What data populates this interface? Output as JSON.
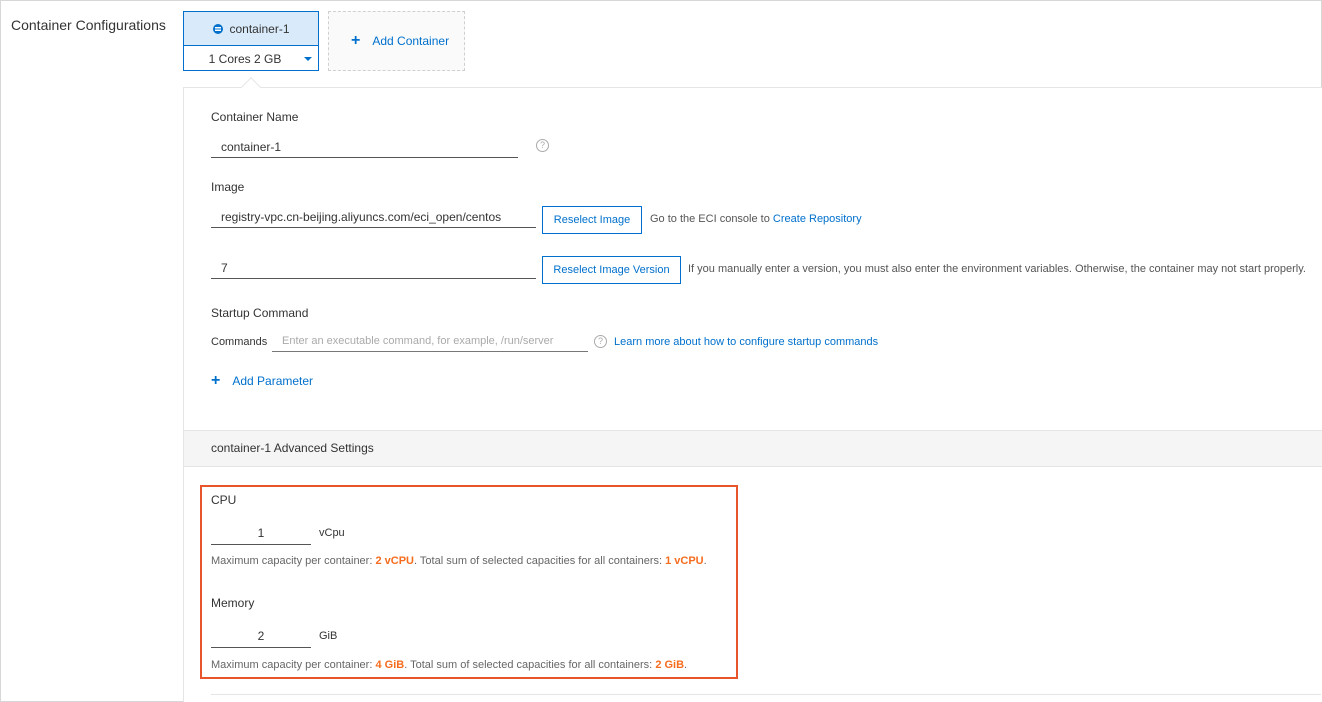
{
  "section": {
    "label": "Container Configurations"
  },
  "container_tab": {
    "name": "container-1",
    "spec": "1 Cores 2 GB"
  },
  "add_container": {
    "label": "Add Container"
  },
  "form": {
    "container_name": {
      "label": "Container Name",
      "value": "container-1"
    },
    "image": {
      "label": "Image",
      "value": "registry-vpc.cn-beijing.aliyuncs.com/eci_open/centos",
      "reselect_label": "Reselect Image",
      "hint_prefix": "Go to the ECI console to",
      "hint_link": "Create Repository"
    },
    "image_version": {
      "value": "7",
      "reselect_label": "Reselect Image Version",
      "hint": "If you manually enter a version, you must also enter the environment variables. Otherwise, the container may not start properly."
    },
    "startup": {
      "label": "Startup Command",
      "commands_label": "Commands",
      "commands_placeholder": "Enter an executable command, for example, /run/server",
      "learn_link": "Learn more about how to configure startup commands",
      "add_parameter": "Add Parameter"
    }
  },
  "advanced": {
    "title": "container-1 Advanced Settings",
    "cpu": {
      "label": "CPU",
      "value": "1",
      "unit": "vCpu",
      "cap_prefix": "Maximum capacity per container:",
      "cap_max": "2 vCPU",
      "cap_mid": ". Total sum of selected capacities for all containers:",
      "cap_total": "1 vCPU",
      "cap_end": "."
    },
    "memory": {
      "label": "Memory",
      "value": "2",
      "unit": "GiB",
      "cap_prefix": "Maximum capacity per container:",
      "cap_max": "4 GiB",
      "cap_mid": ". Total sum of selected capacities for all containers:",
      "cap_total": "2 GiB",
      "cap_end": "."
    }
  },
  "colors": {
    "accent": "#0070cc",
    "highlight": "#e8542c",
    "value_orange": "#f56c1d"
  }
}
